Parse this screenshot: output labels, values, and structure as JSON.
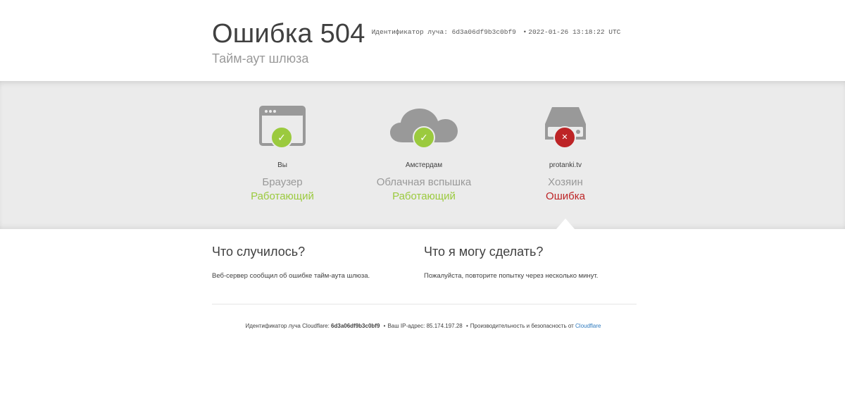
{
  "header": {
    "title": "Ошибка 504",
    "ray_label": "Идентификатор луча:",
    "ray_id": "6d3a06df9b3c0bf9",
    "separator": "•",
    "timestamp": "2022-01-26 13:18:22 UTC",
    "subtitle": "Тайм-аут шлюза"
  },
  "status": {
    "columns": [
      {
        "icon": "browser-icon",
        "location": "Вы",
        "kind": "Браузер",
        "state": "Работающий",
        "badge": "✓",
        "ok": true
      },
      {
        "icon": "cloud-icon",
        "location": "Амстердам",
        "kind": "Облачная вспышка",
        "state": "Работающий",
        "badge": "✓",
        "ok": true
      },
      {
        "icon": "server-icon",
        "location": "protanki.tv",
        "kind": "Хозяин",
        "state": "Ошибка",
        "badge": "✕",
        "ok": false
      }
    ]
  },
  "info": {
    "what_happened": {
      "heading": "Что случилось?",
      "text": "Веб-сервер сообщил об ошибке тайм-аута шлюза."
    },
    "what_to_do": {
      "heading": "Что я могу сделать?",
      "text": "Пожалуйста, повторите попытку через несколько минут."
    }
  },
  "footer": {
    "ray_label": "Идентификатор луча Cloudflare:",
    "ray_id": "6d3a06df9b3c0bf9",
    "sep": "•",
    "ip_label": "Ваш IP-адрес:",
    "ip": "85.174.197.28",
    "perf_label": "Производительность и безопасность от",
    "cloudflare_link": "Cloudflare"
  },
  "colors": {
    "ok": "#9bca3e",
    "error": "#bd2426",
    "icon_gray": "#999999",
    "band": "#ebebeb",
    "link": "#2f7bbf"
  }
}
